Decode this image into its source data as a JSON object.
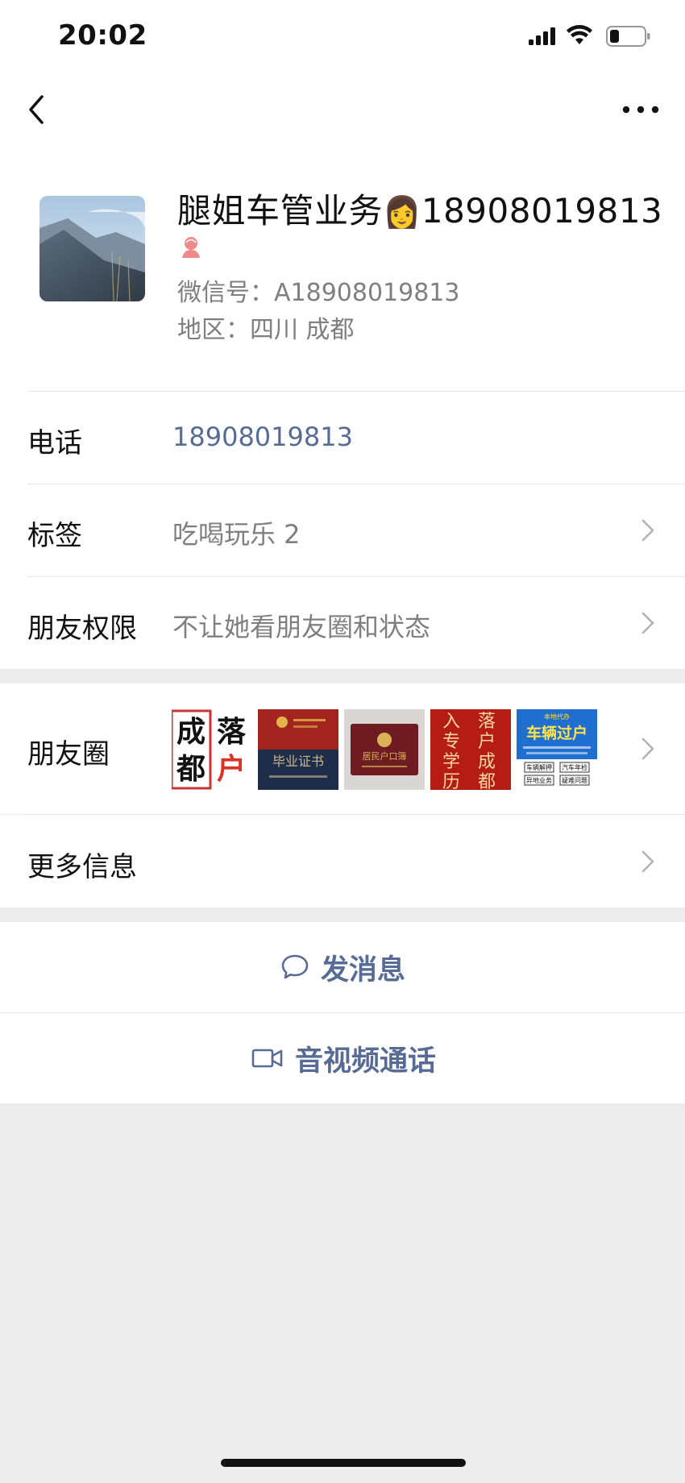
{
  "status": {
    "time": "20:02"
  },
  "colors": {
    "link": "#576b95",
    "secondary_text": "#7f7f7f",
    "background": "#ededed"
  },
  "profile": {
    "name": "腿姐车管业务",
    "name_emoji": "👩",
    "name_suffix": "18908019813",
    "wechat_id": "微信号：A18908019813",
    "region": "地区：四川 成都",
    "gender_icon": "female-icon"
  },
  "rows": {
    "phone": {
      "label": "电话",
      "value": "18908019813"
    },
    "tags": {
      "label": "标签",
      "value": "吃喝玩乐 2"
    },
    "permissions": {
      "label": "朋友权限",
      "value": "不让她看朋友圈和状态"
    },
    "moments": {
      "label": "朋友圈",
      "thumbs": [
        {
          "chars": [
            "成",
            "落",
            "都",
            "户"
          ]
        },
        {
          "chars": [
            "毕业证书"
          ]
        },
        {
          "chars": [
            "居民户口簿"
          ]
        },
        {
          "chars": [
            "入",
            "落",
            "专",
            "户",
            "学",
            "成",
            "历",
            "都"
          ]
        },
        {
          "title": "车辆过户",
          "top": "本地代办",
          "tags": [
            "车辆解押",
            "汽车年检",
            "异地业务",
            "疑难问题"
          ]
        }
      ]
    },
    "more_info": {
      "label": "更多信息"
    }
  },
  "actions": {
    "message": "发消息",
    "call": "音视频通话"
  }
}
